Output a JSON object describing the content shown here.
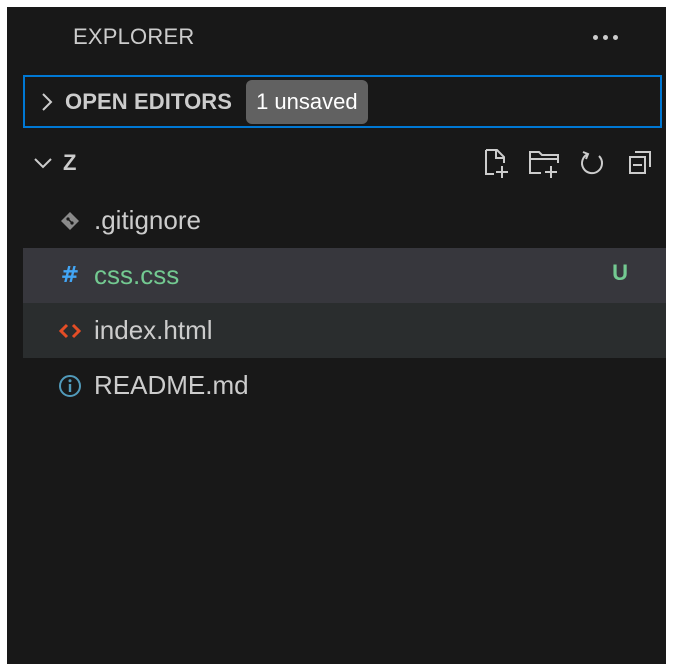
{
  "panel": {
    "title": "EXPLORER",
    "more_actions_icon": "ellipsis-icon"
  },
  "open_editors": {
    "label": "OPEN EDITORS",
    "badge": "1 unsaved",
    "expanded": false
  },
  "folder": {
    "name": "Z",
    "expanded": true,
    "actions": [
      {
        "name": "new-file",
        "icon": "new-file-icon"
      },
      {
        "name": "new-folder",
        "icon": "new-folder-icon"
      },
      {
        "name": "refresh",
        "icon": "refresh-icon"
      },
      {
        "name": "collapse-all",
        "icon": "collapse-all-icon"
      }
    ]
  },
  "files": [
    {
      "name": ".gitignore",
      "icon": "git-diamond-icon",
      "status": "",
      "state": "normal"
    },
    {
      "name": "css.css",
      "icon": "hash-icon",
      "status": "U",
      "state": "selected"
    },
    {
      "name": "index.html",
      "icon": "html-brackets-icon",
      "status": "",
      "state": "hover"
    },
    {
      "name": "README.md",
      "icon": "info-icon",
      "status": "",
      "state": "normal"
    }
  ],
  "colors": {
    "background": "#181818",
    "text": "#cccccc",
    "focus_border": "#0078d4",
    "badge_bg": "#616161",
    "selected_row": "#37373d",
    "hover_row": "#2a2d2e",
    "untracked": "#73c991",
    "css_icon": "#42a5f5",
    "html_icon": "#e44d26",
    "info_icon": "#519aba",
    "gitignore_icon": "#8a8a8a"
  }
}
